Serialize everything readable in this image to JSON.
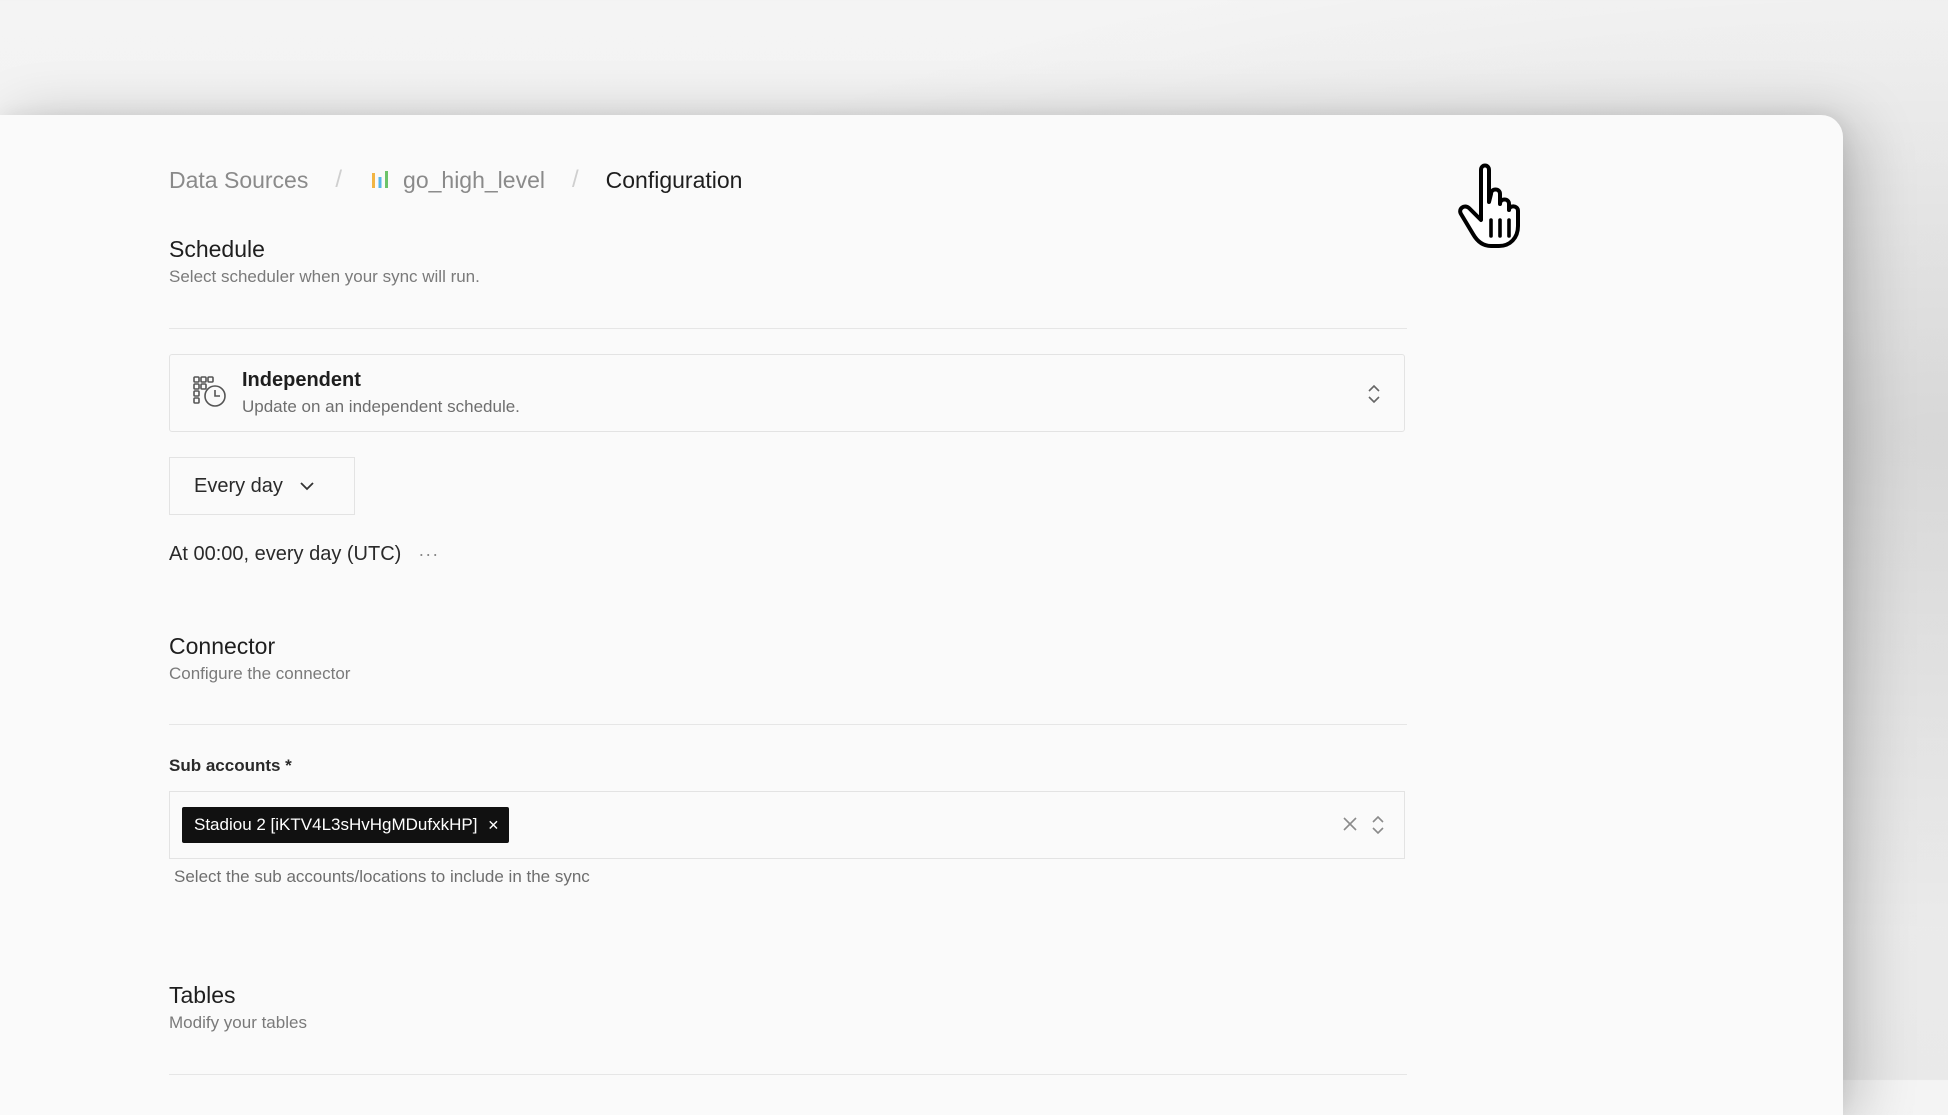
{
  "breadcrumb": {
    "root": "Data Sources",
    "source": "go_high_level",
    "current": "Configuration",
    "separator": "/"
  },
  "schedule": {
    "title": "Schedule",
    "description": "Select scheduler when your sync will run.",
    "selected_name": "Independent",
    "selected_description": "Update on an independent schedule.",
    "frequency_label": "Every day",
    "cron_text": "At 00:00, every day (UTC)",
    "more_glyph": "···"
  },
  "connector": {
    "title": "Connector",
    "description": "Configure the connector",
    "sub_accounts_label": "Sub accounts *",
    "selected_chip": "Stadiou 2 [iKTV4L3sHvHgMDufxkHP]",
    "chip_remove_glyph": "✕",
    "help_text": "Select the sub accounts/locations to include in the sync"
  },
  "tables": {
    "title": "Tables",
    "description": "Modify your tables"
  },
  "colors": {
    "chip_bg": "#111111",
    "page_bg": "#fafafa",
    "muted_text": "#8a8a8a"
  },
  "icons": {
    "source_icon": "bar-chart-icon",
    "schedule_icon": "calendar-clock-icon",
    "select_toggle": "chevron-up-down-icon",
    "dropdown": "chevron-down-icon",
    "clear": "close-icon",
    "cursor": "hand-pointer-cursor"
  }
}
